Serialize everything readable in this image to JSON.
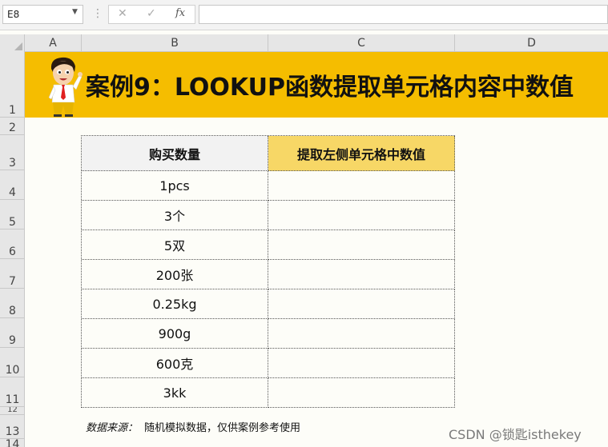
{
  "formula_bar": {
    "name_box": "E8",
    "dots": "⋮",
    "cancel_icon": "✕",
    "enter_icon": "✓",
    "fx_label": "fx",
    "formula": ""
  },
  "columns": [
    "A",
    "B",
    "C",
    "D"
  ],
  "rows": [
    "1",
    "2",
    "3",
    "4",
    "5",
    "6",
    "7",
    "8",
    "9",
    "10",
    "11",
    "12",
    "13",
    "14"
  ],
  "banner": {
    "title": "案例9：LOOKUP函数提取单元格内容中数值",
    "bg_color": "#f5bd00",
    "icon": "cartoon-character-icon"
  },
  "table": {
    "headers": [
      "购买数量",
      "提取左侧单元格中数值"
    ],
    "rows": [
      [
        "1pcs",
        ""
      ],
      [
        "3个",
        ""
      ],
      [
        "5双",
        ""
      ],
      [
        "200张",
        ""
      ],
      [
        "0.25kg",
        ""
      ],
      [
        "900g",
        ""
      ],
      [
        "600克",
        ""
      ],
      [
        "3kk",
        ""
      ]
    ]
  },
  "note": {
    "label": "数据来源：",
    "text": "随机模拟数据，仅供案例参考使用"
  },
  "watermark": "CSDN @锁匙isthekey"
}
